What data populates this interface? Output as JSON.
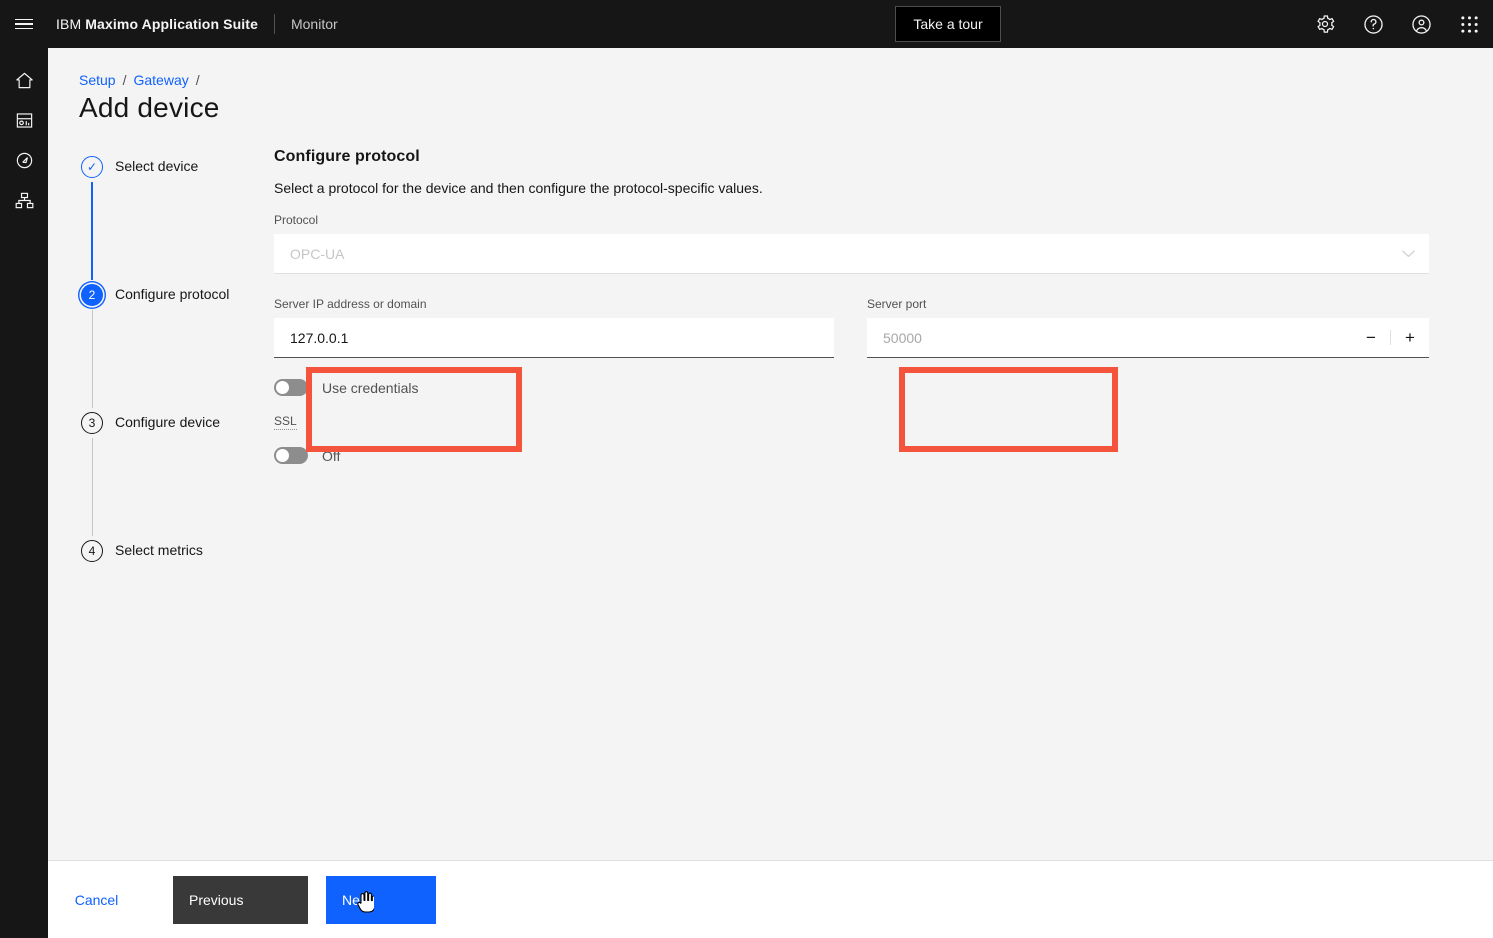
{
  "header": {
    "menu_icon": "hamburger-icon",
    "brand_prefix": "IBM",
    "brand_name": "Maximo Application Suite",
    "sub_brand": "Monitor",
    "tour_button": "Take a tour",
    "icons": [
      {
        "name": "gear-icon",
        "label": "Settings"
      },
      {
        "name": "help-icon",
        "label": "Help"
      },
      {
        "name": "user-avatar-icon",
        "label": "Account"
      },
      {
        "name": "app-switcher-icon",
        "label": "App switcher"
      }
    ]
  },
  "rail": {
    "items": [
      {
        "name": "home-icon",
        "label": "Home"
      },
      {
        "name": "dashboard-icon",
        "label": "Dashboard"
      },
      {
        "name": "explore-icon",
        "label": "Explore"
      },
      {
        "name": "hierarchy-icon",
        "label": "Devices"
      }
    ]
  },
  "breadcrumb": {
    "items": [
      "Setup",
      "Gateway"
    ],
    "separator": "/"
  },
  "page": {
    "title": "Add device"
  },
  "stepper": {
    "steps": [
      {
        "label": "Select device",
        "number": "✓",
        "state": "done"
      },
      {
        "label": "Configure protocol",
        "number": "2",
        "state": "current"
      },
      {
        "label": "Configure device",
        "number": "3",
        "state": "todo"
      },
      {
        "label": "Select metrics",
        "number": "4",
        "state": "todo"
      }
    ]
  },
  "form": {
    "title": "Configure protocol",
    "description": "Select a protocol for the device and then configure the protocol-specific values.",
    "protocol": {
      "label": "Protocol",
      "value": "OPC-UA",
      "chevron": "chevron-down-icon"
    },
    "server_ip": {
      "label": "Server IP address or domain",
      "value": "127.0.0.1",
      "placeholder": "127.0.0.1"
    },
    "server_port": {
      "label": "Server port",
      "value": "50000",
      "placeholder": "50000",
      "decrement": "−",
      "increment": "+"
    },
    "use_credentials": {
      "label": "Use credentials",
      "state": "off"
    },
    "ssl": {
      "label": "SSL",
      "state_label": "Off"
    }
  },
  "footer": {
    "cancel": "Cancel",
    "previous": "Previous",
    "next": "Next"
  },
  "colors": {
    "accent_blue": "#0f62fe",
    "header_black": "#161616",
    "page_gray": "#f4f4f4",
    "annotation_red": "#f4543c",
    "previous_gray": "#393939"
  }
}
